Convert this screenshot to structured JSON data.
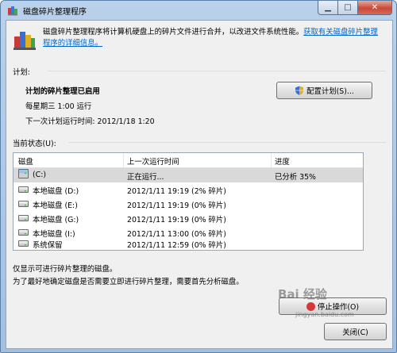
{
  "window": {
    "title": "磁盘碎片整理程序"
  },
  "intro": {
    "text": "磁盘碎片整理程序将计算机硬盘上的碎片文件进行合并，以改进文件系统性能。",
    "link": "获取有关磁盘碎片整理程序的详细信息。"
  },
  "schedule": {
    "section_label": "计划:",
    "status": "计划的碎片整理已启用",
    "run_time": "每星期三  1:00 运行",
    "next_run": "下一次计划运行时间: 2012/1/18 1:20",
    "configure_button": "配置计划(S)..."
  },
  "current_status": {
    "section_label": "当前状态(U):",
    "columns": [
      "磁盘",
      "上一次运行时间",
      "进度"
    ],
    "rows": [
      {
        "name": "(C:)",
        "time": "正在运行...",
        "progress": "已分析 35%"
      },
      {
        "name": "本地磁盘 (D:)",
        "time": "2012/1/11 19:19 (2% 碎片)",
        "progress": ""
      },
      {
        "name": "本地磁盘 (E:)",
        "time": "2012/1/11 19:19 (0% 碎片)",
        "progress": ""
      },
      {
        "name": "本地磁盘 (G:)",
        "time": "2012/1/11 19:19 (0% 碎片)",
        "progress": ""
      },
      {
        "name": "本地磁盘 (I:)",
        "time": "2012/1/11 13:00 (0% 碎片)",
        "progress": ""
      },
      {
        "name": "系统保留",
        "time": "2012/1/11 12:59 (0% 碎片)",
        "progress": ""
      }
    ]
  },
  "notes": {
    "line1": "仅显示可进行碎片整理的磁盘。",
    "line2": "为了最好地确定磁盘是否需要立即进行碎片整理，需要首先分析磁盘。"
  },
  "buttons": {
    "stop": "停止操作(O)",
    "close": "关闭(C)"
  },
  "watermark": {
    "text": "Bai 经验",
    "url": "jingyan.baidu.com"
  }
}
